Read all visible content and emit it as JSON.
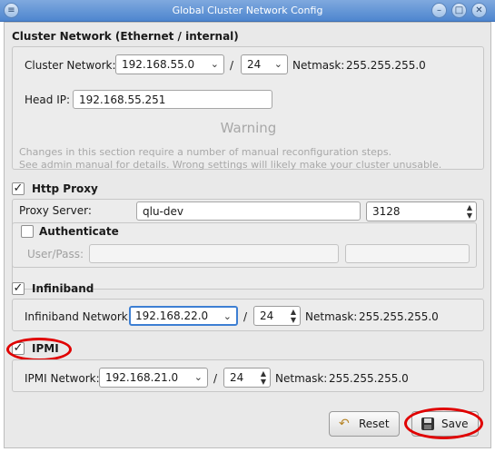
{
  "window": {
    "title": "Global Cluster Network Config"
  },
  "cluster": {
    "heading": "Cluster Network (Ethernet / internal)",
    "network_label": "Cluster Network:",
    "network_value": "192.168.55.0",
    "slash": "/",
    "prefix": "24",
    "netmask_label": "Netmask:",
    "netmask_value": "255.255.255.0",
    "headip_label": "Head IP:",
    "headip_value": "192.168.55.251",
    "warning_title": "Warning",
    "warning_line1": "Changes in this section require a number of manual reconfiguration steps.",
    "warning_line2": "See admin manual for details. Wrong settings will likely make your cluster unusable."
  },
  "proxy": {
    "checkbox_label": "Http Proxy",
    "checked": true,
    "server_label": "Proxy Server:",
    "server_value": "qlu-dev",
    "port_value": "3128",
    "auth_label": "Authenticate",
    "auth_checked": false,
    "userpass_label": "User/Pass:"
  },
  "infiniband": {
    "checkbox_label": "Infiniband",
    "checked": true,
    "network_label": "Infiniband Network:",
    "network_value": "192.168.22.0",
    "slash": "/",
    "prefix": "24",
    "netmask_label": "Netmask:",
    "netmask_value": "255.255.255.0"
  },
  "ipmi": {
    "checkbox_label": "IPMI",
    "checked": true,
    "network_label": "IPMI Network:",
    "network_value": "192.168.21.0",
    "slash": "/",
    "prefix": "24",
    "netmask_label": "Netmask:",
    "netmask_value": "255.255.255.0"
  },
  "buttons": {
    "reset_label": "Reset",
    "save_label": "Save"
  },
  "colors": {
    "titlebar": "#5b8fd4",
    "highlight": "#e00000",
    "focus": "#3d7fd3"
  },
  "icons": {
    "menu": "menu-icon",
    "minimize": "minimize-icon",
    "maximize": "maximize-icon",
    "close": "close-icon",
    "reset": "undo-icon",
    "save": "floppy-disk-icon"
  }
}
